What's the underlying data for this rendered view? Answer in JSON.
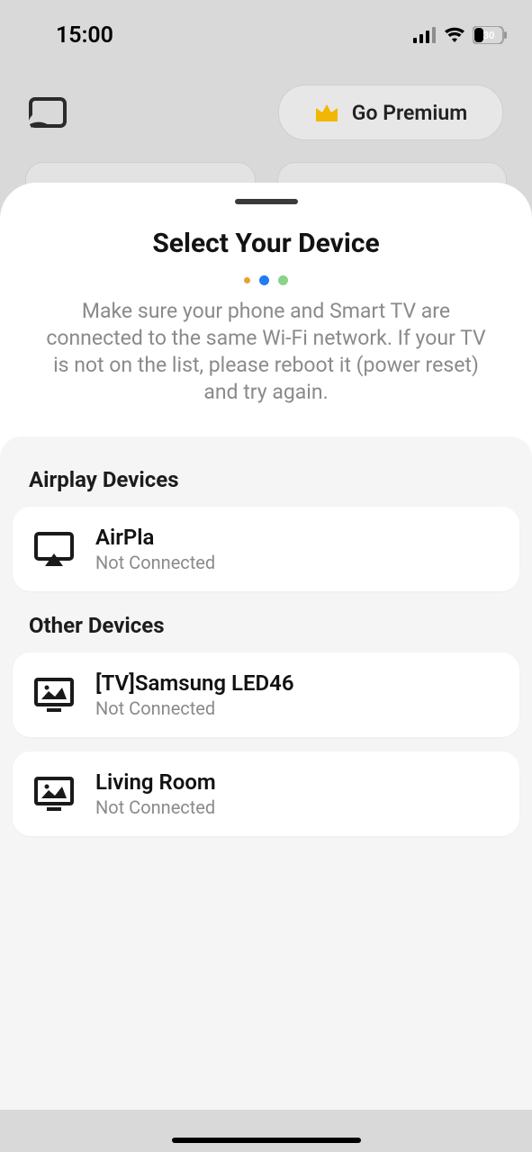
{
  "status": {
    "time": "15:00",
    "battery": "30"
  },
  "header": {
    "premium_label": "Go Premium"
  },
  "sheet": {
    "title": "Select Your Device",
    "description": "Make sure your phone and Smart TV are connected to the same Wi-Fi network. If your TV is not on the list, please reboot it (power reset) and try again."
  },
  "sections": {
    "airplay_title": "Airplay Devices",
    "other_title": "Other Devices"
  },
  "devices": {
    "airplay": [
      {
        "name": "AirPla",
        "status": "Not Connected"
      }
    ],
    "other": [
      {
        "name": "[TV]Samsung LED46",
        "status": "Not Connected"
      },
      {
        "name": "Living Room",
        "status": "Not Connected"
      }
    ]
  }
}
